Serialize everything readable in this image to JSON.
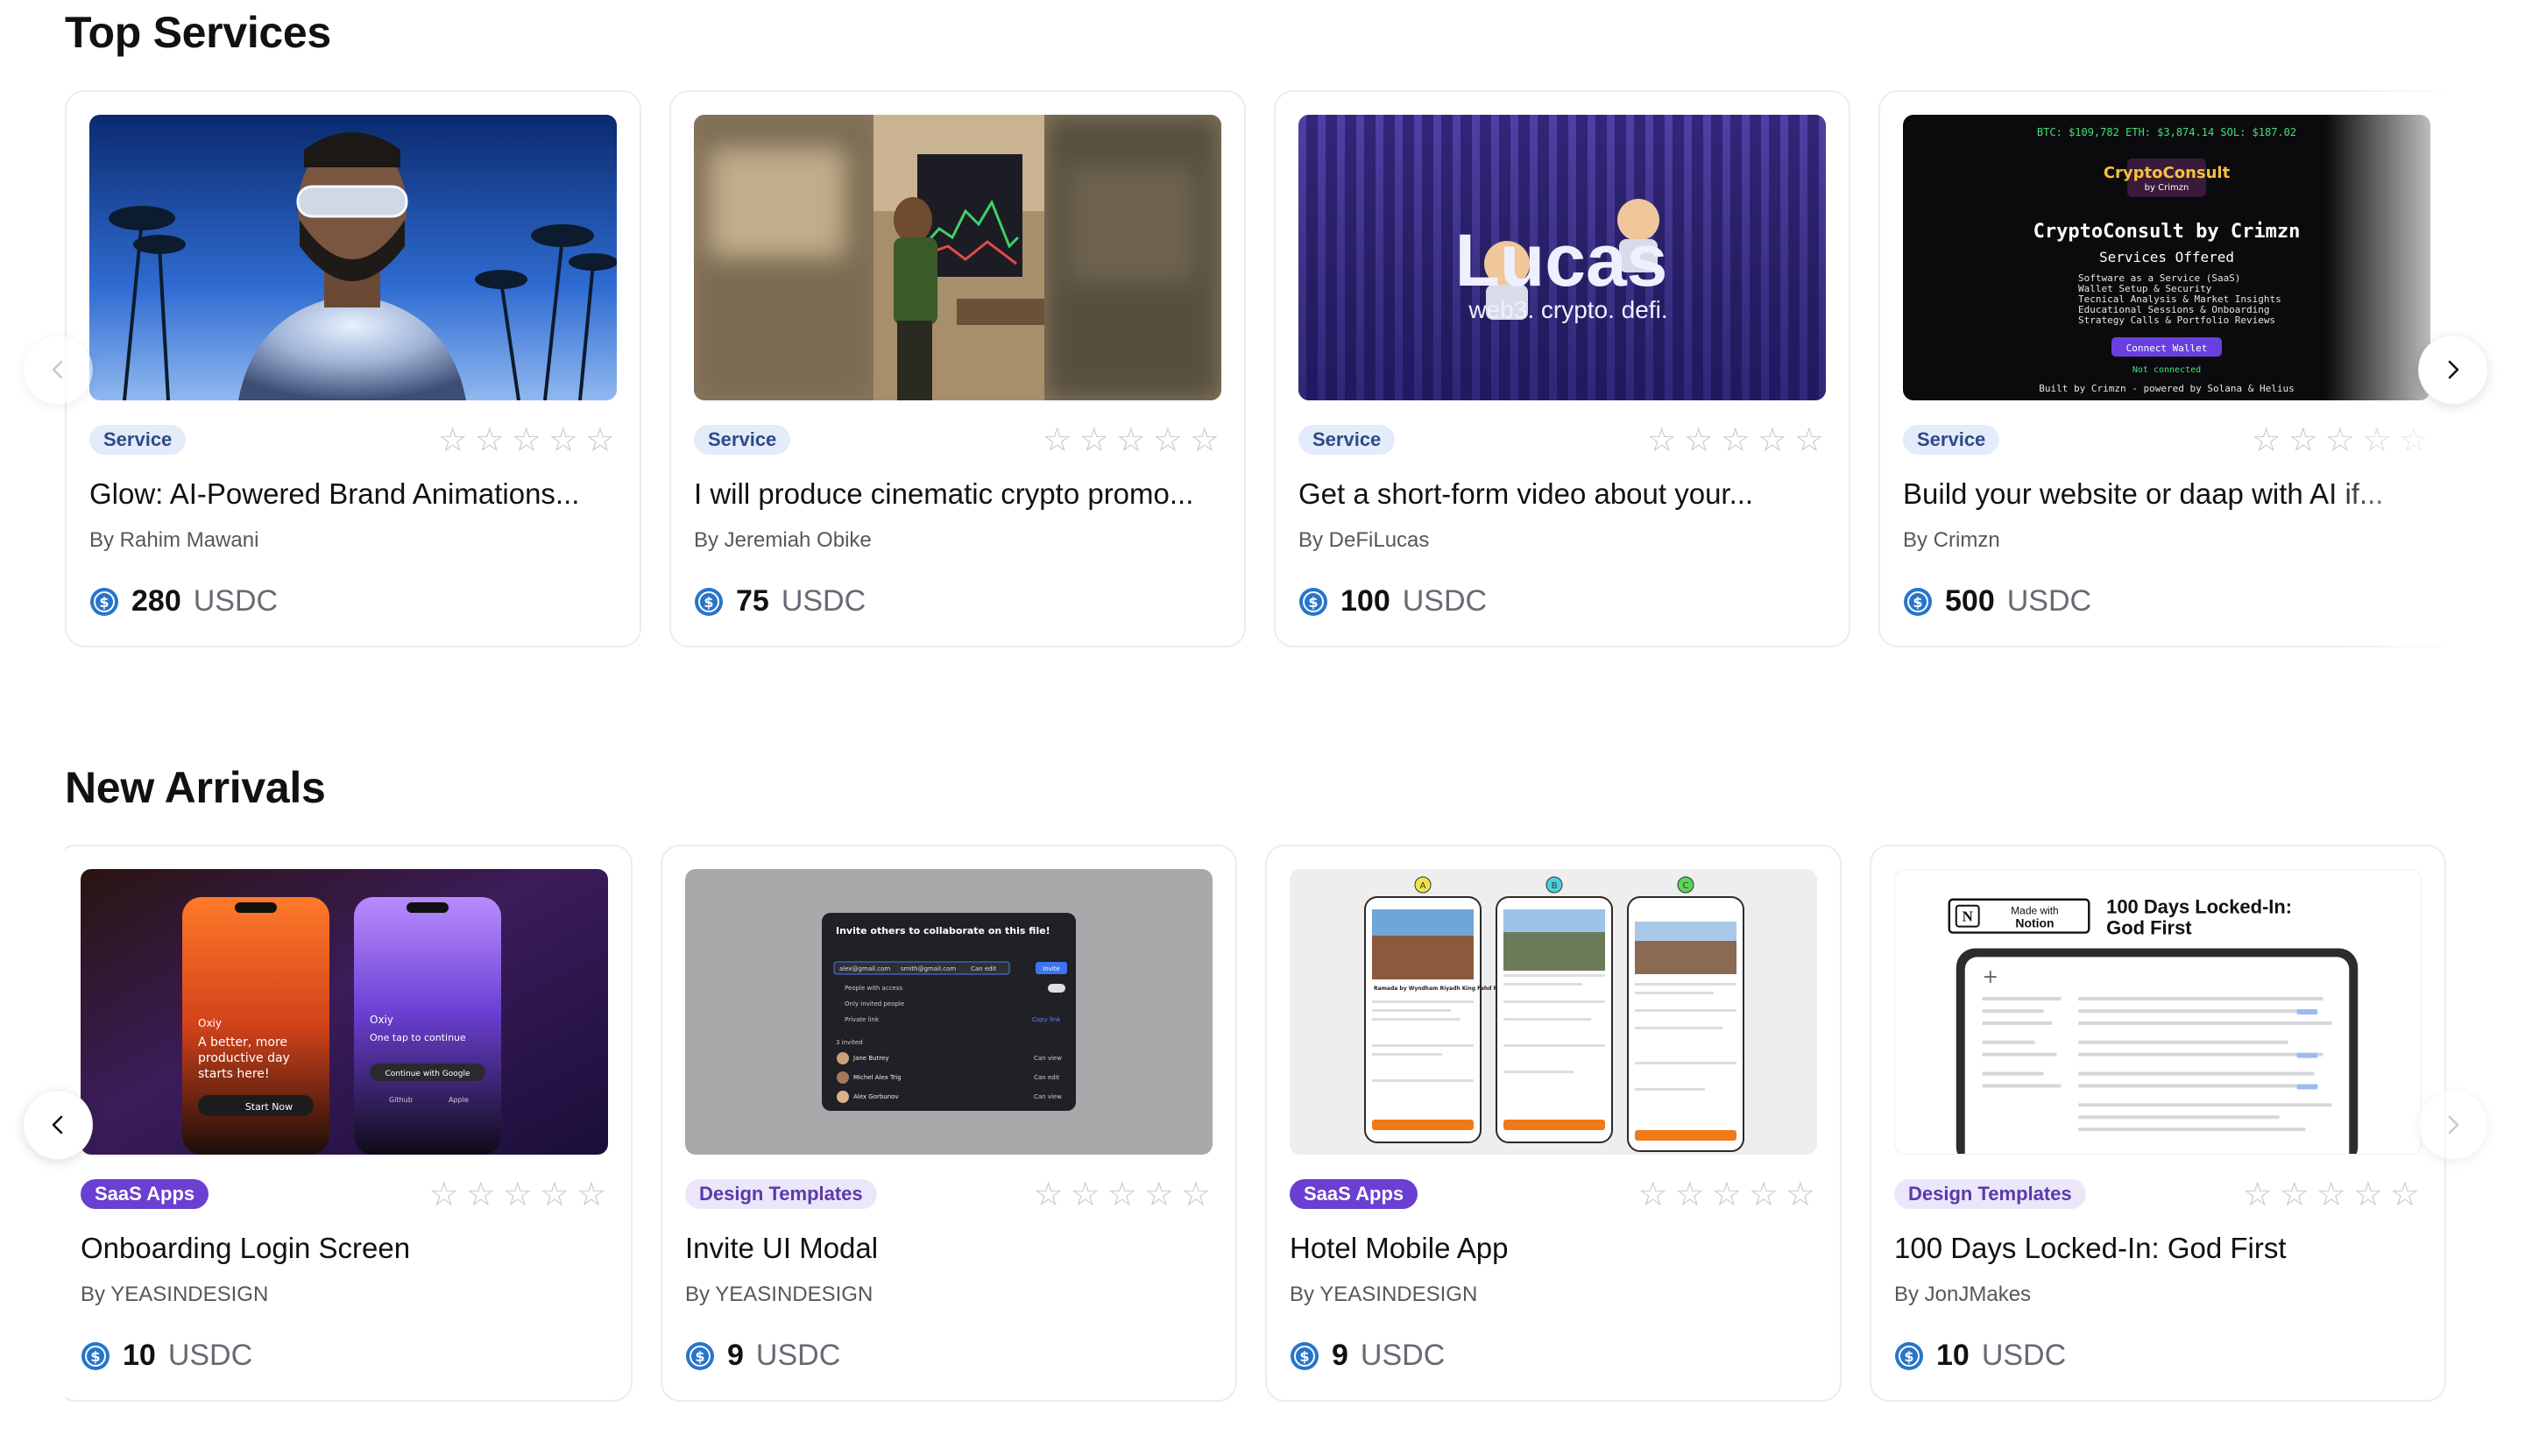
{
  "sections": [
    {
      "title": "Top Services",
      "cards": [
        {
          "category": "Service",
          "title": "Glow: AI-Powered Brand Animations...",
          "author": "By Rahim Mawani",
          "price": "280",
          "currency": "USDC",
          "rating": 0
        },
        {
          "category": "Service",
          "title": "I will produce cinematic crypto promo...",
          "author": "By Jeremiah Obike",
          "price": "75",
          "currency": "USDC",
          "rating": 0
        },
        {
          "category": "Service",
          "title": "Get a short-form video about your...",
          "author": "By DeFiLucas",
          "price": "100",
          "currency": "USDC",
          "rating": 0
        },
        {
          "category": "Service",
          "title": "Build your website or daap with AI if...",
          "author": "By Crimzn",
          "price": "500",
          "currency": "USDC",
          "rating": 0
        }
      ]
    },
    {
      "title": "New Arrivals",
      "cards": [
        {
          "category": "SaaS Apps",
          "title": "Onboarding Login Screen",
          "author": "By YEASINDESIGN",
          "price": "10",
          "currency": "USDC",
          "rating": 0
        },
        {
          "category": "Design Templates",
          "title": "Invite UI Modal",
          "author": "By YEASINDESIGN",
          "price": "9",
          "currency": "USDC",
          "rating": 0
        },
        {
          "category": "SaaS Apps",
          "title": "Hotel Mobile App",
          "author": "By YEASINDESIGN",
          "price": "9",
          "currency": "USDC",
          "rating": 0
        },
        {
          "category": "Design Templates",
          "title": "100 Days Locked-In: God First",
          "author": "By JonJMakes",
          "price": "10",
          "currency": "USDC",
          "rating": 0
        }
      ]
    }
  ],
  "thumbnails": {
    "lucas": {
      "name": "Lucas",
      "tagline": "web3. crypto. defi."
    },
    "crypto": {
      "ticker": "BTC: $109,782   ETH: $3,874.14   SOL: $187.02",
      "logo": "CryptoConsult",
      "logo_sub": "by Crimzn",
      "heading": "CryptoConsult by Crimzn",
      "services_title": "Services Offered",
      "services": [
        "Software as a Service (SaaS)",
        "Wallet Setup & Security",
        "Tecnical Analysis & Market Insights",
        "Educational Sessions & Onboarding",
        "Strategy Calls & Portfolio Reviews"
      ],
      "connect": "Connect Wallet",
      "status": "Not connected",
      "footer": "Built by Crimzn - powered by Solana & Helius"
    },
    "onboarding": {
      "brand": "Oxiy",
      "headline": "A better, more productive day starts here!",
      "cta": "Start Now",
      "brand2": "Oxiy",
      "headline2": "One tap to continue",
      "google": "Continue with Google",
      "github": "Github",
      "apple": "Apple"
    },
    "invite": {
      "title": "Invite others to collaborate on this file!",
      "button": "Invite",
      "email1": "alex@gmail.com",
      "email2": "smith@gmail.com",
      "perm": "Can edit",
      "people_access": "People with access",
      "invited_only": "Only invited people",
      "private_link": "Private link",
      "copy_link": "Copy link",
      "invited_count": "3 invited",
      "invitees": [
        {
          "name": "Jane Butrey",
          "role": "Can view"
        },
        {
          "name": "Michel Alex Trig",
          "role": "Can edit"
        },
        {
          "name": "Alex Gorbunov",
          "role": "Can view"
        }
      ]
    },
    "hotel": {
      "markers": [
        "A",
        "B",
        "C"
      ],
      "hotel_name": "Ramada by Wyndham Riyadh King Fahd Road"
    },
    "notion": {
      "made_with": "Made with",
      "notion": "Notion",
      "title": "100 Days Locked-In: God First"
    }
  },
  "colors": {
    "accent_saas": "#6b3fd1",
    "badge_service_bg": "#e4ebfb",
    "usdc_blue": "#2775ca"
  },
  "icons": {
    "prev": "chevron-left-icon",
    "next": "chevron-right-icon",
    "coin": "usdc-coin-icon",
    "star": "star-outline-icon"
  }
}
